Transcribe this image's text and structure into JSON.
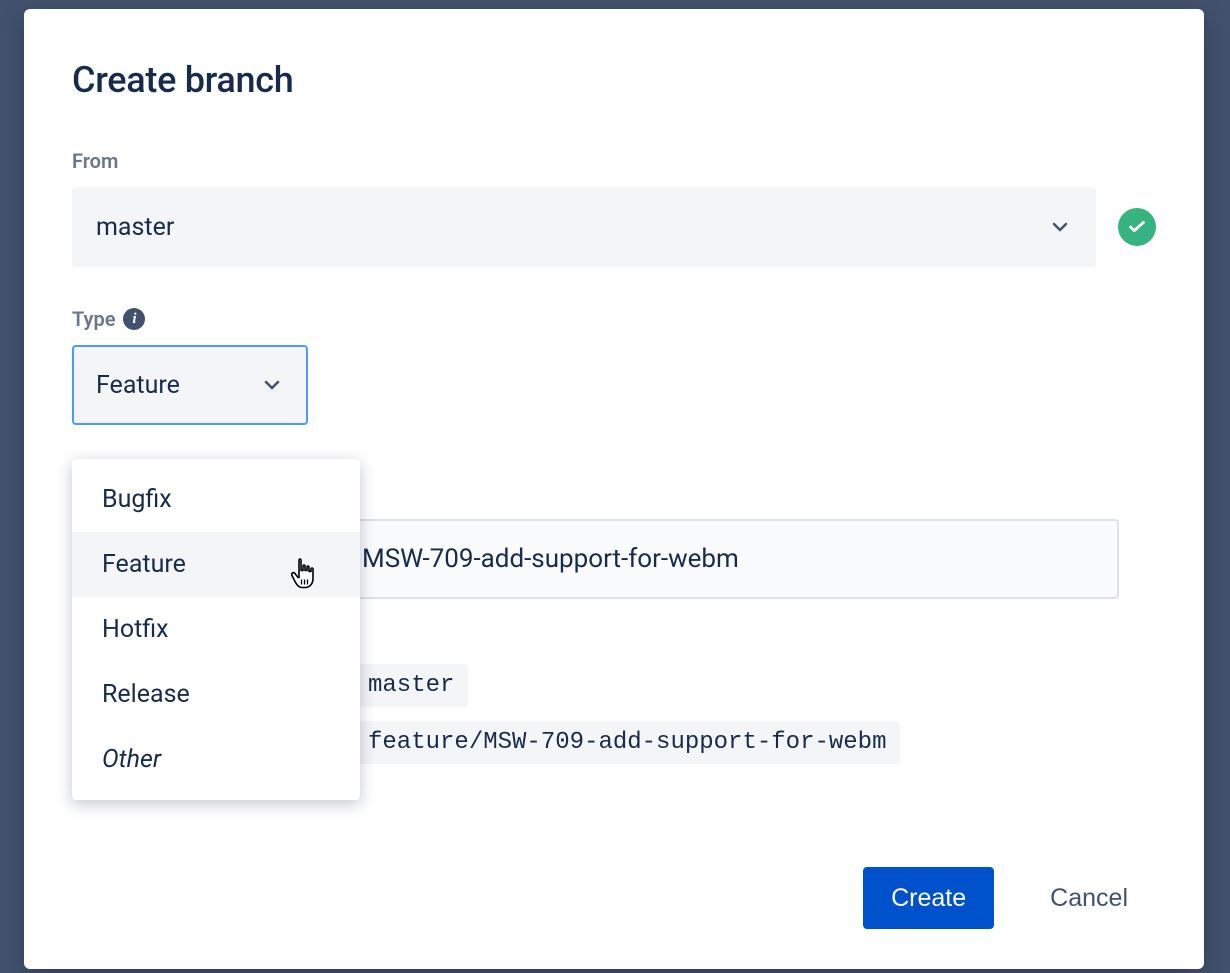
{
  "dialog": {
    "title": "Create branch",
    "from": {
      "label": "From",
      "value": "master"
    },
    "type": {
      "label": "Type",
      "value": "Feature",
      "options": [
        "Bugfix",
        "Feature",
        "Hotfix",
        "Release",
        "Other"
      ]
    },
    "branch_name": {
      "value": "MSW-709-add-support-for-webm"
    },
    "code": {
      "master": "master",
      "feature": "feature/MSW-709-add-support-for-webm"
    },
    "buttons": {
      "create": "Create",
      "cancel": "Cancel"
    }
  }
}
